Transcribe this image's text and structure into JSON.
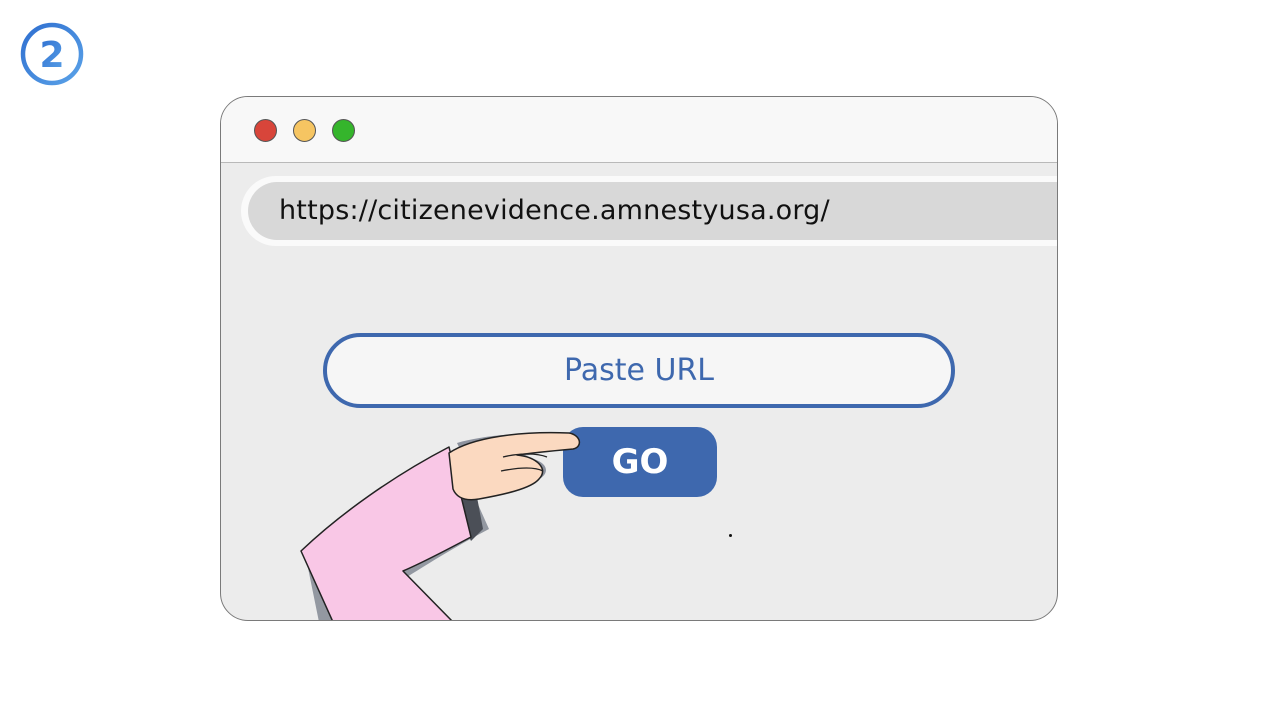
{
  "step": {
    "number": "2",
    "color": "#3b78c9"
  },
  "window": {
    "controls": [
      {
        "name": "close",
        "color": "#d8453a"
      },
      {
        "name": "minimize",
        "color": "#f6c562"
      },
      {
        "name": "maximize",
        "color": "#35b52c"
      }
    ]
  },
  "address_bar": {
    "url": "https://citizenevidence.amnestyusa.org/"
  },
  "form": {
    "input_placeholder": "Paste URL",
    "button_label": "GO",
    "accent_color": "#3e68ae"
  },
  "illustration": {
    "icon": "pointing-hand-icon",
    "sleeve_color": "#f9c7e6",
    "skin_color": "#fbd9c0"
  }
}
